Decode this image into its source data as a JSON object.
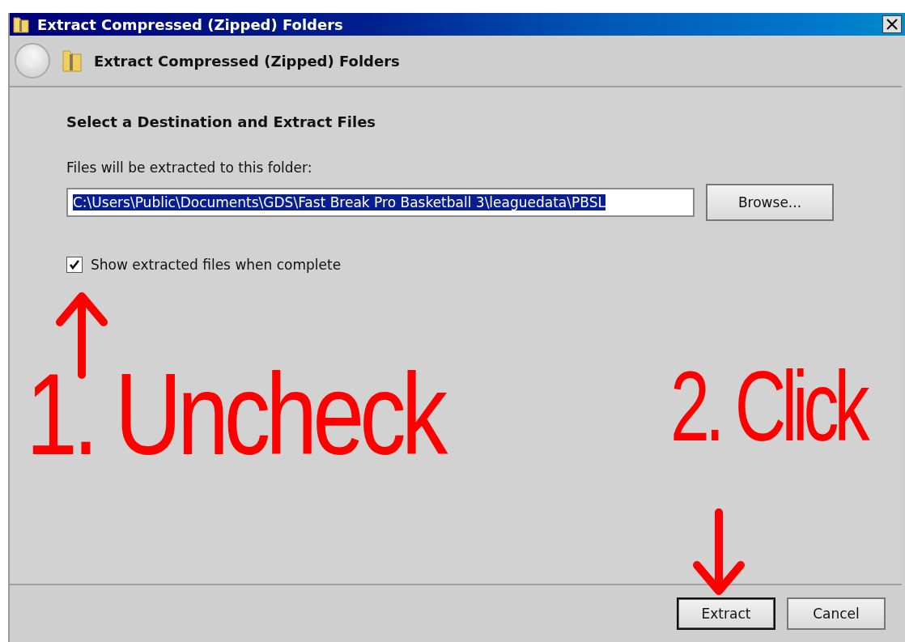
{
  "window": {
    "title": "Extract Compressed (Zipped) Folders"
  },
  "header": {
    "title": "Extract Compressed (Zipped) Folders"
  },
  "content": {
    "heading": "Select a Destination and Extract Files",
    "label": "Files will be extracted to this folder:",
    "path_field": {
      "value": "C:\\Users\\Public\\Documents\\GDS\\Fast Break Pro Basketball 3\\leaguedata\\PBSL",
      "selected": true
    },
    "browse_button": "Browse...",
    "checkbox": {
      "label": "Show extracted files when complete",
      "checked": true
    }
  },
  "buttons": [
    {
      "label": "Extract",
      "default": true
    },
    {
      "label": "Cancel",
      "default": false
    }
  ],
  "annotations": [
    {
      "text": "1. Uncheck",
      "kind": "up"
    },
    {
      "text": "2. Click",
      "kind": "down"
    }
  ]
}
